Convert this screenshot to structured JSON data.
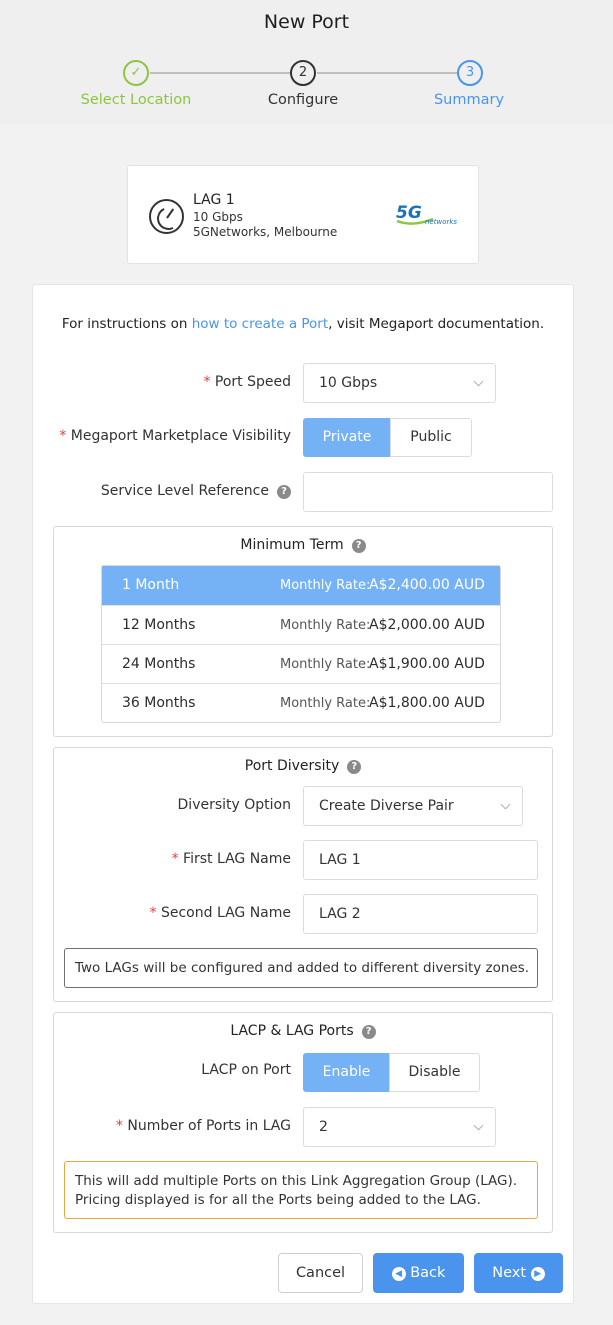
{
  "page": {
    "title": "New Port"
  },
  "steps": [
    {
      "label": "Select Location",
      "marker": "✓",
      "color": "#8cc63f"
    },
    {
      "label": "Configure",
      "marker": "2",
      "color": "#333333"
    },
    {
      "label": "Summary",
      "marker": "3",
      "color": "#4a94ee"
    }
  ],
  "provider": {
    "name": "LAG 1",
    "speed": "10 Gbps",
    "location": "5GNetworks, Melbourne",
    "logo_text": "5G",
    "logo_sub": "networks",
    "icon": "speedometer-icon"
  },
  "instructions": {
    "prefix": "For instructions on ",
    "link": "how to create a Port",
    "suffix": ", visit Megaport documentation."
  },
  "fields": {
    "port_speed": {
      "label": "Port Speed",
      "value": "10 Gbps"
    },
    "visibility": {
      "label": "Megaport Marketplace Visibility",
      "options": [
        "Private",
        "Public"
      ],
      "selected": "Private"
    },
    "service_ref": {
      "label": "Service Level Reference",
      "value": ""
    }
  },
  "minimum_term": {
    "title": "Minimum Term",
    "rate_label": "Monthly Rate:",
    "rows": [
      {
        "term": "1 Month",
        "price": "A$2,400.00 AUD",
        "selected": true
      },
      {
        "term": "12 Months",
        "price": "A$2,000.00 AUD",
        "selected": false
      },
      {
        "term": "24 Months",
        "price": "A$1,900.00 AUD",
        "selected": false
      },
      {
        "term": "36 Months",
        "price": "A$1,800.00 AUD",
        "selected": false
      }
    ]
  },
  "diversity": {
    "title": "Port Diversity",
    "option_label": "Diversity Option",
    "option_value": "Create Diverse Pair",
    "first_label": "First LAG Name",
    "first_value": "LAG 1",
    "second_label": "Second LAG Name",
    "second_value": "LAG 2",
    "notice": "Two LAGs will be configured and added to different diversity zones."
  },
  "lacp": {
    "title": "LACP & LAG Ports",
    "lacp_label": "LACP on Port",
    "options": [
      "Enable",
      "Disable"
    ],
    "selected": "Enable",
    "ports_label": "Number of Ports in LAG",
    "ports_value": "2",
    "notice": "This will add multiple Ports on this Link Aggregation Group (LAG). Pricing displayed is for all the Ports being added to the LAG."
  },
  "buttons": {
    "cancel": "Cancel",
    "back": "Back",
    "next": "Next"
  },
  "colors": {
    "accent": "#4a94ee",
    "selected": "#75b2f5",
    "success": "#8cc63f",
    "required": "#e4403d",
    "warning": "#e8a93a"
  }
}
